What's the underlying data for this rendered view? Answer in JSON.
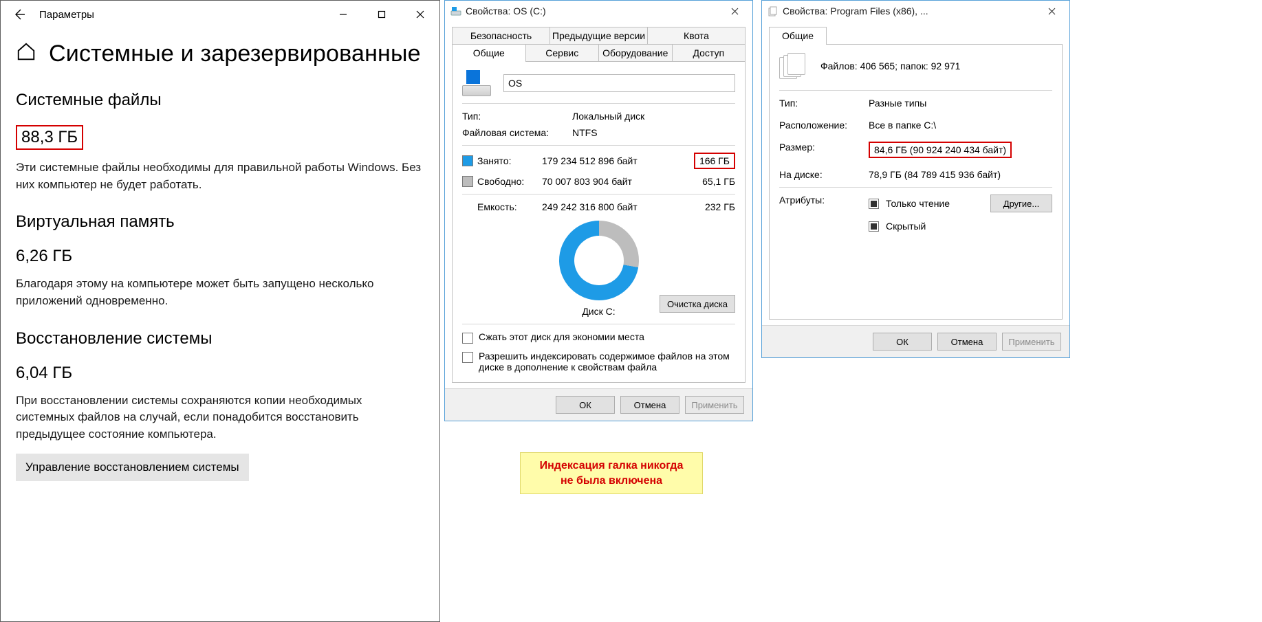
{
  "settings": {
    "window_title": "Параметры",
    "heading": "Системные и зарезервированные",
    "sections": {
      "system_files": {
        "title": "Системные файлы",
        "value": "88,3 ГБ",
        "desc": "Эти системные файлы необходимы для правильной работы Windows. Без них компьютер не будет работать."
      },
      "virtual_memory": {
        "title": "Виртуальная память",
        "value": "6,26 ГБ",
        "desc": "Благодаря этому на компьютере может быть запущено несколько приложений одновременно."
      },
      "system_restore": {
        "title": "Восстановление системы",
        "value": "6,04 ГБ",
        "desc": "При восстановлении системы сохраняются копии необходимых системных файлов на случай, если понадобится восстановить предыдущее состояние компьютера.",
        "button": "Управление восстановлением системы"
      }
    }
  },
  "disk": {
    "window_title": "Свойства: OS (C:)",
    "tabs_row1": [
      "Безопасность",
      "Предыдущие версии",
      "Квота"
    ],
    "tabs_row2": [
      "Общие",
      "Сервис",
      "Оборудование",
      "Доступ"
    ],
    "active_tab": "Общие",
    "name_value": "OS",
    "type_label": "Тип:",
    "type_value": "Локальный диск",
    "fs_label": "Файловая система:",
    "fs_value": "NTFS",
    "used_label": "Занято:",
    "used_bytes": "179 234 512 896 байт",
    "used_gb": "166 ГБ",
    "free_label": "Свободно:",
    "free_bytes": "70 007 803 904 байт",
    "free_gb": "65,1 ГБ",
    "capacity_label": "Емкость:",
    "capacity_bytes": "249 242 316 800 байт",
    "capacity_gb": "232 ГБ",
    "donut_label": "Диск C:",
    "cleanup_button": "Очистка диска",
    "compress_chk": "Сжать этот диск для экономии места",
    "index_chk": "Разрешить индексировать содержимое файлов на этом диске в дополнение к свойствам файла",
    "buttons": {
      "ok": "ОК",
      "cancel": "Отмена",
      "apply": "Применить"
    }
  },
  "folder": {
    "window_title": "Свойства: Program Files (x86), ...",
    "tab": "Общие",
    "counts": "Файлов: 406 565; папок: 92 971",
    "type_label": "Тип:",
    "type_value": "Разные типы",
    "location_label": "Расположение:",
    "location_value": "Все в папке C:\\",
    "size_label": "Размер:",
    "size_value": "84,6 ГБ (90 924 240 434 байт)",
    "ondisk_label": "На диске:",
    "ondisk_value": "78,9 ГБ (84 789 415 936 байт)",
    "attr_label": "Атрибуты:",
    "attr_readonly": "Только чтение",
    "attr_hidden": "Скрытый",
    "other_button": "Другие...",
    "buttons": {
      "ok": "ОК",
      "cancel": "Отмена",
      "apply": "Применить"
    }
  },
  "note": {
    "line1": "Индексация галка никогда",
    "line2": "не была включена"
  }
}
